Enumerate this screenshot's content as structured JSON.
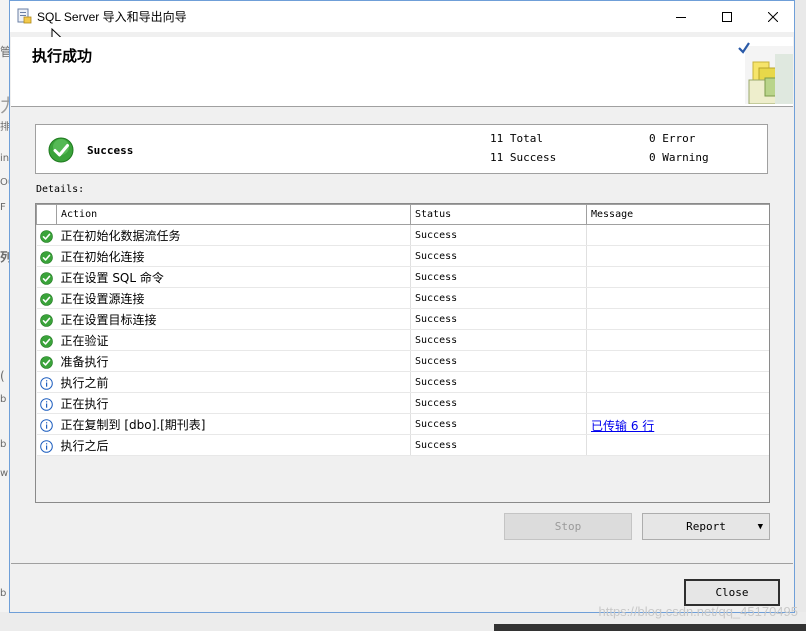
{
  "window": {
    "title": "SQL Server 导入和导出向导",
    "controls": {
      "minimize": "—",
      "maximize": "☐",
      "close": "✕"
    }
  },
  "header": {
    "title": "执行成功"
  },
  "summary": {
    "status": "Success",
    "total": "11 Total",
    "success": "11 Success",
    "error": "0 Error",
    "warning": "0 Warning"
  },
  "details": {
    "label": "Details:",
    "columns": [
      "Action",
      "Status",
      "Message"
    ],
    "rows": [
      {
        "icon": "success-icon",
        "action": "正在初始化数据流任务",
        "status": "Success",
        "message": ""
      },
      {
        "icon": "success-icon",
        "action": "正在初始化连接",
        "status": "Success",
        "message": ""
      },
      {
        "icon": "success-icon",
        "action": "正在设置 SQL 命令",
        "status": "Success",
        "message": ""
      },
      {
        "icon": "success-icon",
        "action": "正在设置源连接",
        "status": "Success",
        "message": ""
      },
      {
        "icon": "success-icon",
        "action": "正在设置目标连接",
        "status": "Success",
        "message": ""
      },
      {
        "icon": "success-icon",
        "action": "正在验证",
        "status": "Success",
        "message": ""
      },
      {
        "icon": "success-icon",
        "action": "准备执行",
        "status": "Success",
        "message": ""
      },
      {
        "icon": "info-icon",
        "action": "执行之前",
        "status": "Success",
        "message": ""
      },
      {
        "icon": "info-icon",
        "action": "正在执行",
        "status": "Success",
        "message": ""
      },
      {
        "icon": "info-icon",
        "action": "正在复制到 [dbo].[期刊表]",
        "status": "Success",
        "message": "已传输 6 行"
      },
      {
        "icon": "info-icon",
        "action": "执行之后",
        "status": "Success",
        "message": ""
      }
    ]
  },
  "buttons": {
    "stop": "Stop",
    "report": "Report",
    "close": "Close"
  },
  "watermark": "https://blog.csdn.net/qq_45170495",
  "background_app": {
    "left_fragments": [
      "管",
      "力",
      "排",
      "in",
      "Ou",
      "F",
      "列",
      "(",
      "b",
      "b",
      "w",
      "b"
    ]
  },
  "colors": {
    "success_green": "#3aa33a",
    "info_blue": "#1f5fbf",
    "link_blue": "#0000ee",
    "window_border": "#6f9fd8"
  }
}
